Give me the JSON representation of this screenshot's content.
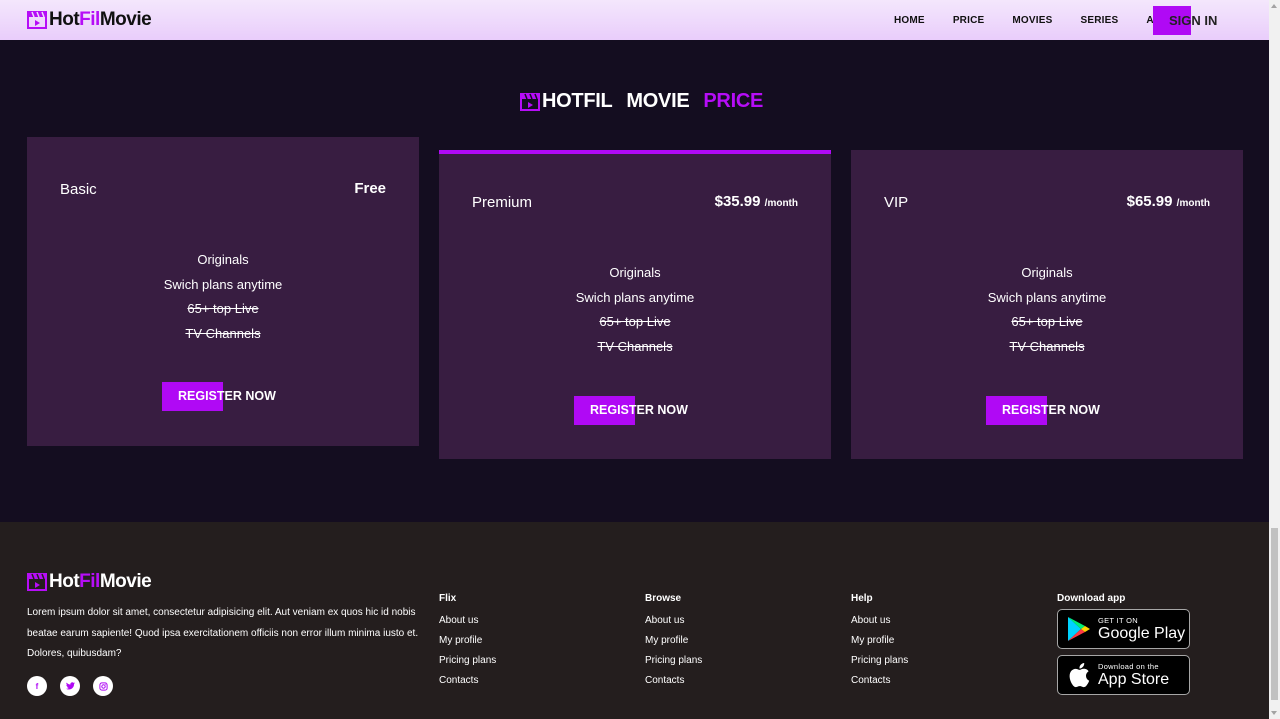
{
  "header": {
    "logo": {
      "part1": "Hot",
      "part2": "Fil",
      "part3": "Movie"
    },
    "nav": [
      "HOME",
      "PRICE",
      "MOVIES",
      "SERIES",
      "ABOUT"
    ],
    "signin": "SIGN IN"
  },
  "section": {
    "title": {
      "part1": "HOTFIL",
      "part2": "MOVIE",
      "part3": "PRICE"
    }
  },
  "plans": [
    {
      "name": "Basic",
      "price": "Free",
      "period": "",
      "features": [
        "Originals",
        "Swich plans anytime"
      ],
      "struck": [
        "65+ top Live",
        "TV Channels"
      ],
      "button": "REGISTER NOW"
    },
    {
      "name": "Premium",
      "price": "$35.99",
      "period": "/month",
      "features": [
        "Originals",
        "Swich plans anytime"
      ],
      "struck": [
        "65+ top Live",
        "TV Channels"
      ],
      "button": "REGISTER NOW"
    },
    {
      "name": "VIP",
      "price": "$65.99",
      "period": "/month",
      "features": [
        "Originals",
        "Swich plans anytime"
      ],
      "struck": [
        "65+ top Live",
        "TV Channels"
      ],
      "button": "REGISTER NOW"
    }
  ],
  "footer": {
    "logo": {
      "part1": "Hot",
      "part2": "Fil",
      "part3": "Movie"
    },
    "description": "Lorem ipsum dolor sit amet, consectetur adipisicing elit. Aut veniam ex quos hic id nobis beatae earum sapiente! Quod ipsa exercitationem officiis non error illum minima iusto et. Dolores, quibusdam?",
    "socials": [
      "facebook-icon",
      "twitter-icon",
      "instagram-icon"
    ],
    "columns": [
      {
        "heading": "Flix",
        "links": [
          "About us",
          "My profile",
          "Pricing plans",
          "Contacts"
        ]
      },
      {
        "heading": "Browse",
        "links": [
          "About us",
          "My profile",
          "Pricing plans",
          "Contacts"
        ]
      },
      {
        "heading": "Help",
        "links": [
          "About us",
          "My profile",
          "Pricing plans",
          "Contacts"
        ]
      }
    ],
    "download": {
      "heading": "Download app",
      "google": {
        "small": "GET IT ON",
        "big": "Google Play"
      },
      "apple": {
        "small": "Download on the",
        "big": "App Store"
      }
    }
  },
  "colors": {
    "accent": "#b009f5",
    "background": "#140d20",
    "card": "#381d41",
    "footer": "#241e1e"
  }
}
